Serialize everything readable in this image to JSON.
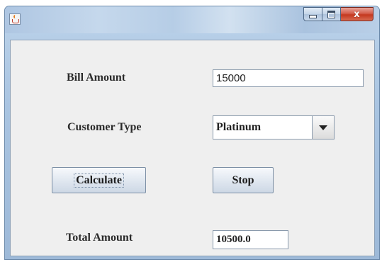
{
  "window": {
    "controls": {
      "minimize": "minimize",
      "maximize": "maximize",
      "close": "x"
    }
  },
  "form": {
    "bill_amount": {
      "label": "Bill Amount",
      "value": "15000"
    },
    "customer_type": {
      "label": "Customer Type",
      "selected": "Platinum"
    },
    "calculate_label": "Calculate",
    "stop_label": "Stop",
    "total_amount": {
      "label": "Total Amount",
      "value": "10500.0"
    }
  },
  "icons": {
    "app": "java-cup-icon",
    "dropdown": "triangle-down-icon"
  },
  "colors": {
    "panel": "#efefef",
    "title_bar": "#b9cfe7",
    "close_button": "#c4381f"
  }
}
